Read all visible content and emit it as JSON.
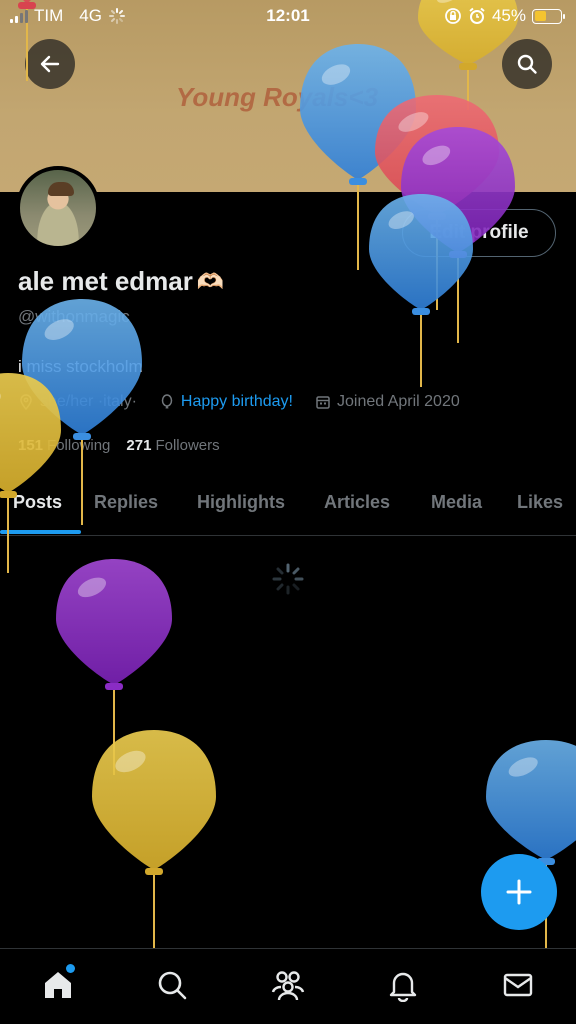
{
  "status": {
    "carrier": "TIM",
    "network": "4G",
    "time": "12:01",
    "battery": "45%"
  },
  "banner": {
    "text": "Young Royals<3"
  },
  "profile": {
    "edit_label": "Edit profile",
    "name": "ale met edmar",
    "name_emoji": "🫶🏻",
    "handle": "@withonmagic",
    "bio": "i miss stockholm",
    "location": "she/her ·italy·",
    "website": "Happy birthday!",
    "joined": "Joined April 2020",
    "following_count": "151",
    "following_label": "Following",
    "followers_count": "271",
    "followers_label": "Followers"
  },
  "tabs": [
    "Posts",
    "Replies",
    "Highlights",
    "Articles",
    "Media",
    "Likes"
  ],
  "colors": {
    "accent": "#1d9bf0",
    "banner": "#c2a671"
  },
  "nav": [
    "home-icon",
    "search-icon",
    "communities-icon",
    "notifications-icon",
    "messages-icon"
  ]
}
